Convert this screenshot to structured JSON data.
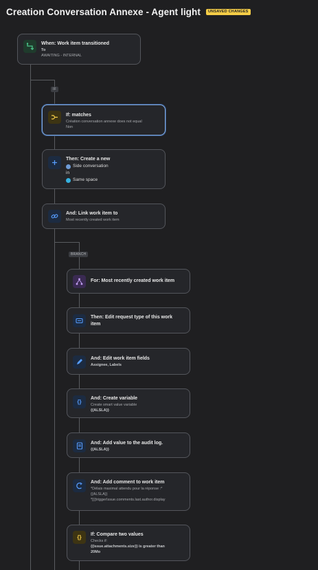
{
  "header": {
    "title": "Creation Conversation Annexe - Agent light",
    "badge": "UNSAVED CHANGES"
  },
  "tags": {
    "if": "IF",
    "branch": "BRANCH"
  },
  "trigger": {
    "heading": "When: Work item transitioned",
    "to_label": "To",
    "to_value": "AWAITING - INTERNAL",
    "icon": "transition-icon"
  },
  "condition": {
    "heading": "If: matches",
    "line1": "Création conversation annexe does not equal",
    "line2": "Non",
    "icon": "branch-condition-icon"
  },
  "create_action": {
    "heading": "Then: Create a new",
    "item_label": "Side conversation",
    "in_label": "in",
    "space_label": "Same space",
    "icon": "plus-icon"
  },
  "link_action": {
    "heading": "And: Link work item to",
    "sub": "Most recently created work item",
    "icon": "link-icon"
  },
  "branch_for": {
    "heading": "For: Most recently created work item",
    "icon": "branch-icon"
  },
  "edit_request": {
    "heading": "Then: Edit request type of this work item",
    "icon": "request-type-icon"
  },
  "edit_fields": {
    "heading": "And: Edit work item fields",
    "sub": "Assignee, Labels",
    "icon": "pencil-icon"
  },
  "create_variable": {
    "heading": "And: Create variable",
    "sub": "Create smart value variable",
    "value": "{{ALSLA}}",
    "icon": "variable-icon"
  },
  "audit_log": {
    "heading": "And: Add value to the audit log.",
    "value": "{{ALSLA}}",
    "icon": "audit-log-icon"
  },
  "add_comment": {
    "heading": "And: Add comment to work item",
    "line1": "*Délais maximal attendu pour la réponse :*",
    "line2": "{{ALSLA}}",
    "line3": "*[{{triggerIssue.comments.last.author.display",
    "icon": "comment-icon"
  },
  "compare": {
    "heading": "If: Compare two values",
    "line1": "Checks if:",
    "line2": "{{issue.attachments.size}} is greater than",
    "line3": "20Mo",
    "icon": "compare-icon"
  },
  "colors": {
    "background": "#1f1f21",
    "badge": "#f5cd47",
    "selected_border": "#7fa9e0"
  }
}
